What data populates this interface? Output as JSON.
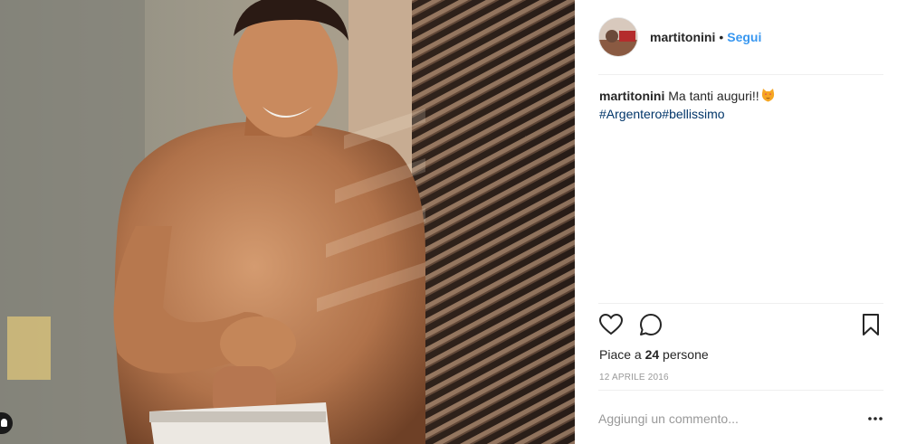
{
  "post": {
    "username": "martitonini",
    "separator": "•",
    "follow_label": "Segui",
    "caption_user": "martitonini",
    "caption_text": "Ma tanti auguri!!",
    "caption_emoji": "cat-face-emoji",
    "hashtags": [
      "#Argentero",
      "#bellissimo"
    ],
    "likes_prefix": "Piace a ",
    "likes_count": "24",
    "likes_suffix": " persone",
    "date": "12 APRILE 2016",
    "comment_placeholder": "Aggiungi un commento..."
  },
  "icons": {
    "like": "heart-icon",
    "comment": "comment-bubble-icon",
    "save": "bookmark-icon",
    "more": "more-options-icon",
    "tag": "user-tag-icon"
  },
  "colors": {
    "link": "#3897f0",
    "hashtag": "#003569",
    "text": "#262626",
    "muted": "#999999",
    "divider": "#efefef"
  }
}
